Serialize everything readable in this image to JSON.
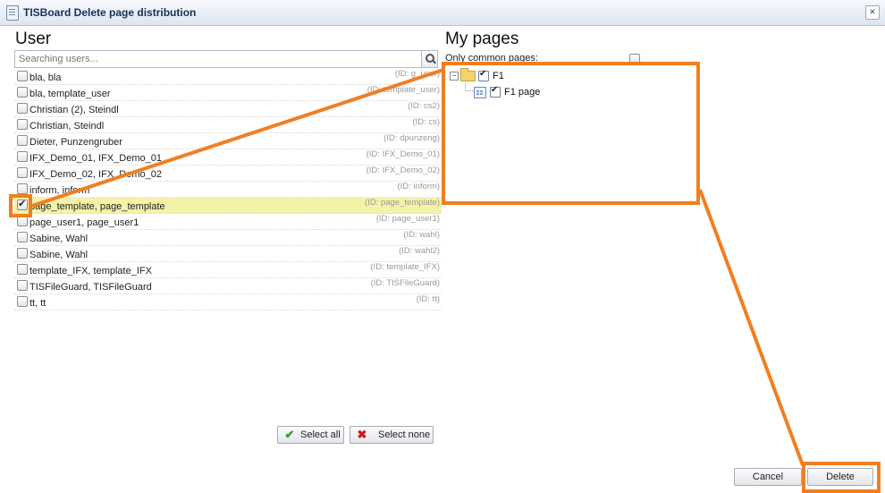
{
  "window": {
    "title": "TISBoard Delete page distribution",
    "close_label": "×"
  },
  "users_panel": {
    "heading": "User",
    "search_placeholder": "Searching users...",
    "rows": [
      {
        "name": "bla, bla",
        "id": "(ID: g_user)",
        "checked": false
      },
      {
        "name": "bla, template_user",
        "id": "(ID: template_user)",
        "checked": false
      },
      {
        "name": "Christian (2), Steindl",
        "id": "(ID: cs2)",
        "checked": false
      },
      {
        "name": "Christian, Steindl",
        "id": "(ID: cs)",
        "checked": false
      },
      {
        "name": "Dieter, Punzengruber",
        "id": "(ID: dpunzeng)",
        "checked": false
      },
      {
        "name": "IFX_Demo_01, IFX_Demo_01",
        "id": "(ID: IFX_Demo_01)",
        "checked": false
      },
      {
        "name": "IFX_Demo_02, IFX_Demo_02",
        "id": "(ID: IFX_Demo_02)",
        "checked": false
      },
      {
        "name": "inform, inform",
        "id": "(ID: inform)",
        "checked": false
      },
      {
        "name": "page_template, page_template",
        "id": "(ID: page_template)",
        "checked": true
      },
      {
        "name": "page_user1, page_user1",
        "id": "(ID: page_user1)",
        "checked": false
      },
      {
        "name": "Sabine, Wahl",
        "id": "(ID: wahl)",
        "checked": false
      },
      {
        "name": "Sabine, Wahl",
        "id": "(ID: wahl2)",
        "checked": false
      },
      {
        "name": "template_IFX, template_IFX",
        "id": "(ID: template_IFX)",
        "checked": false
      },
      {
        "name": "TISFileGuard, TISFileGuard",
        "id": "(ID: TISFileGuard)",
        "checked": false
      },
      {
        "name": "tt, tt",
        "id": "(ID: tt)",
        "checked": false
      }
    ],
    "select_all_label": "Select all",
    "select_none_label": "Select none"
  },
  "pages_panel": {
    "heading": "My pages",
    "only_common_label": "Only common pages:",
    "only_common_checked": false,
    "tree": {
      "folder": {
        "label": "F1",
        "checked": true,
        "expanded": true
      },
      "page": {
        "label": "F1 page",
        "checked": true
      }
    }
  },
  "footer": {
    "cancel_label": "Cancel",
    "delete_label": "Delete"
  },
  "annotation": {
    "color": "#f07f21"
  }
}
